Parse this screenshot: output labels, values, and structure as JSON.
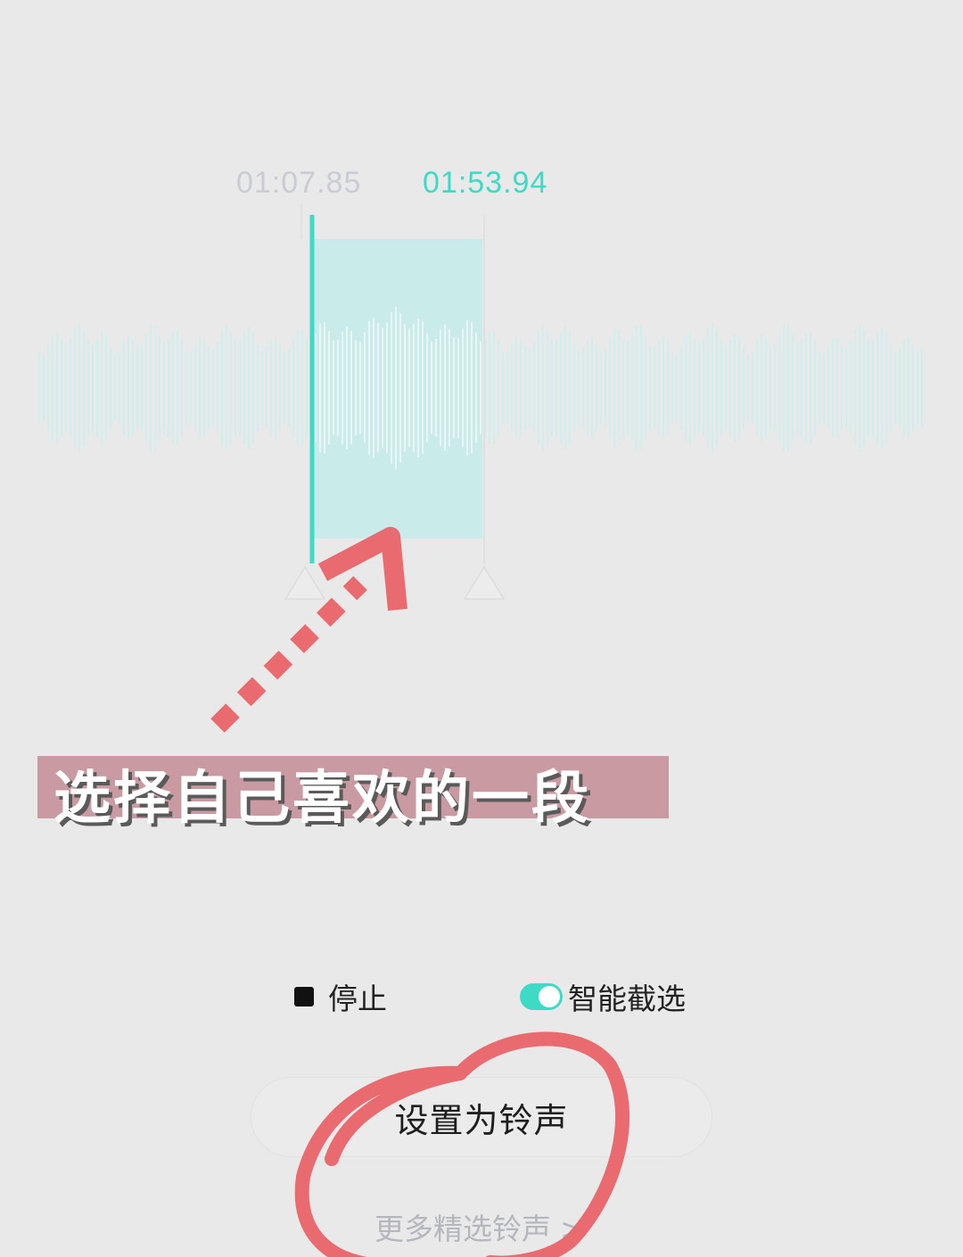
{
  "colors": {
    "background": "#e9e9e9",
    "accent": "#3ddbc6",
    "accent_light": "#c8eae9",
    "start_time_color": "#c9ccd4",
    "annotation_red": "#e96469",
    "caption_bg": "#c99aa2"
  },
  "trim": {
    "start_time": "01:07.85",
    "end_time": "01:53.94"
  },
  "controls": {
    "stop_label": "停止",
    "stop_icon": "stop-square-icon",
    "smart_label": "智能截选",
    "smart_enabled": true
  },
  "actions": {
    "set_ringtone": "设置为铃声",
    "more_ringtones": "更多精选铃声",
    "more_chevron": ">"
  },
  "overlay": {
    "caption": "选择自己喜欢的一段"
  }
}
